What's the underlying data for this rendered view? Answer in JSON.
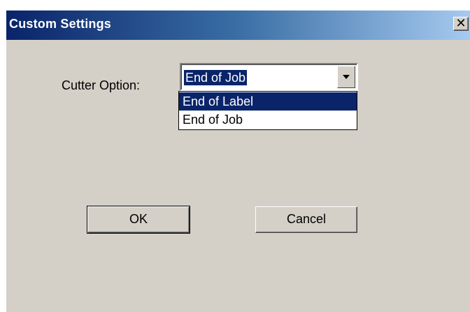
{
  "window": {
    "title": "Custom Settings",
    "close_glyph": "✕"
  },
  "form": {
    "cutter_label": "Cutter Option:",
    "cutter_value": "End of Job",
    "options": [
      "End of Label",
      "End of Job"
    ],
    "highlighted_option": "End of Label"
  },
  "buttons": {
    "ok_label": "OK",
    "cancel_label": "Cancel"
  },
  "colors": {
    "titlebar_start": "#0a246a",
    "titlebar_end": "#a6caf0",
    "dialog_face": "#d4d0c8",
    "selection": "#0a246a"
  },
  "icons": {
    "close": "close-icon",
    "dropdown": "dropdown-arrow-icon"
  }
}
